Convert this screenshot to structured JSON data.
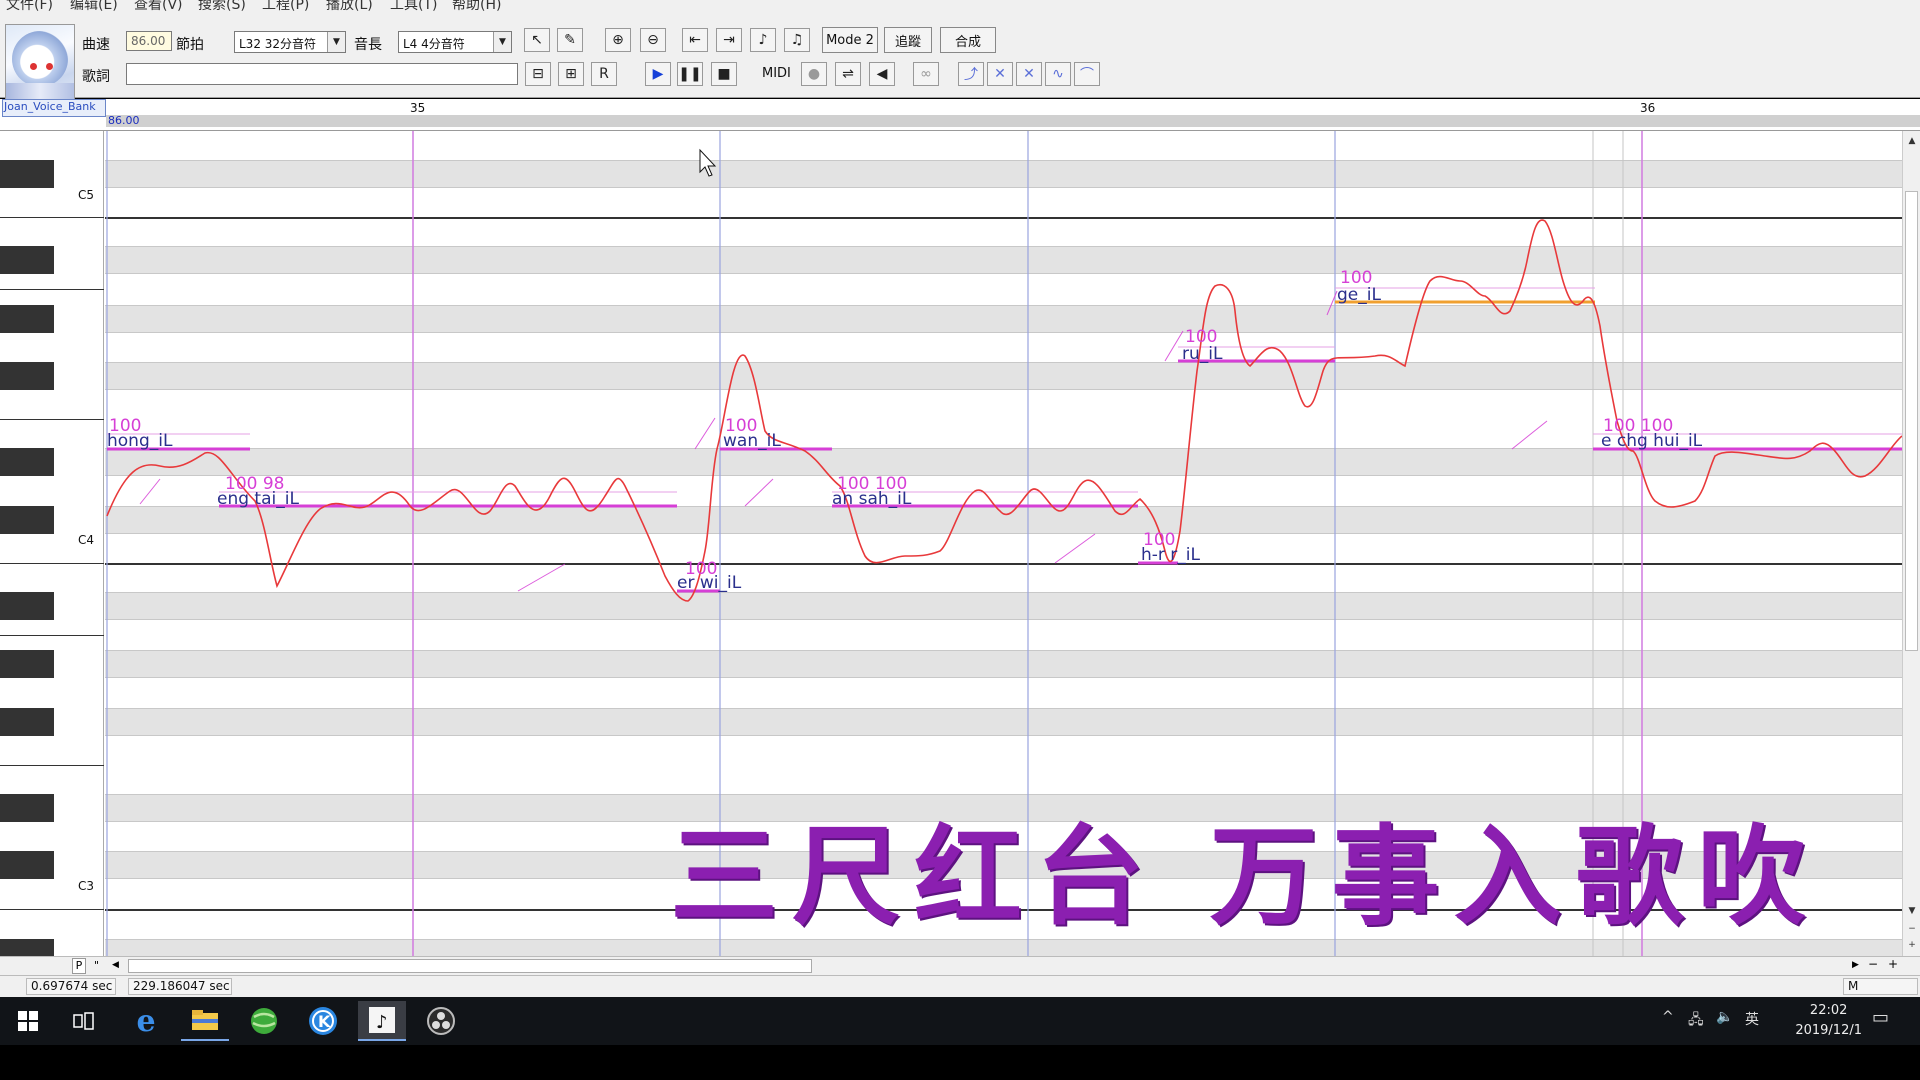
{
  "menubar": {
    "items": [
      "文件(F)",
      "编辑(E)",
      "查看(V)",
      "搜索(S)",
      "工程(P)",
      "播放(L)",
      "工具(T)",
      "帮助(H)"
    ]
  },
  "toolbar": {
    "tempo_label": "曲速",
    "tempo_value": "86.00",
    "beat_label": "節拍",
    "quantize_value": "L32 32分音符",
    "length_label": "音長",
    "length_value": "L4 4分音符",
    "lyric_label": "歌詞",
    "lyric_value": "",
    "mode_label": "Mode 2",
    "follow_label": "追蹤",
    "synth_label": "合成",
    "midi_label": "MIDI"
  },
  "track": {
    "name": "Joan_Voice_Bank",
    "tempo_marker": "86.00",
    "measures": [
      "35",
      "36"
    ]
  },
  "keyboard": {
    "octave_labels": [
      "C5",
      "C4",
      "C3"
    ]
  },
  "notes": [
    {
      "lyric": "hong_iL",
      "intensity": "100"
    },
    {
      "lyric": "eng tai_iL",
      "intensity": "100 98"
    },
    {
      "lyric": "er wi_iL",
      "intensity": "100"
    },
    {
      "lyric": "wan_iL",
      "intensity": "100"
    },
    {
      "lyric": "an sah_iL",
      "intensity": "100 100"
    },
    {
      "lyric": "h-r r_iL",
      "intensity": "100"
    },
    {
      "lyric": "ru_iL",
      "intensity": "100"
    },
    {
      "lyric": "ge_iL",
      "intensity": "100"
    },
    {
      "lyric": "e chg hui_iL",
      "intensity": "100 100"
    }
  ],
  "caption": "三尺红台 万事入歌吹",
  "statusbar": {
    "position_sec": "0.697674 sec",
    "total_sec": "229.186047 sec",
    "mode_indicator": "M"
  },
  "hscroll": {
    "p_label": "P"
  },
  "taskbar": {
    "icons": [
      "windows-start",
      "task-view",
      "edge",
      "file-explorer",
      "browser",
      "k-app",
      "utau-app",
      "obs"
    ],
    "ime": "英",
    "time": "22:02",
    "date": "2019/12/1"
  },
  "colors": {
    "note_line": "#d63fd6",
    "pitch_curve": "#e8393b",
    "bar_line": "#d17be0",
    "beat_line": "#9aa4de",
    "caption": "#8b1fb0"
  }
}
